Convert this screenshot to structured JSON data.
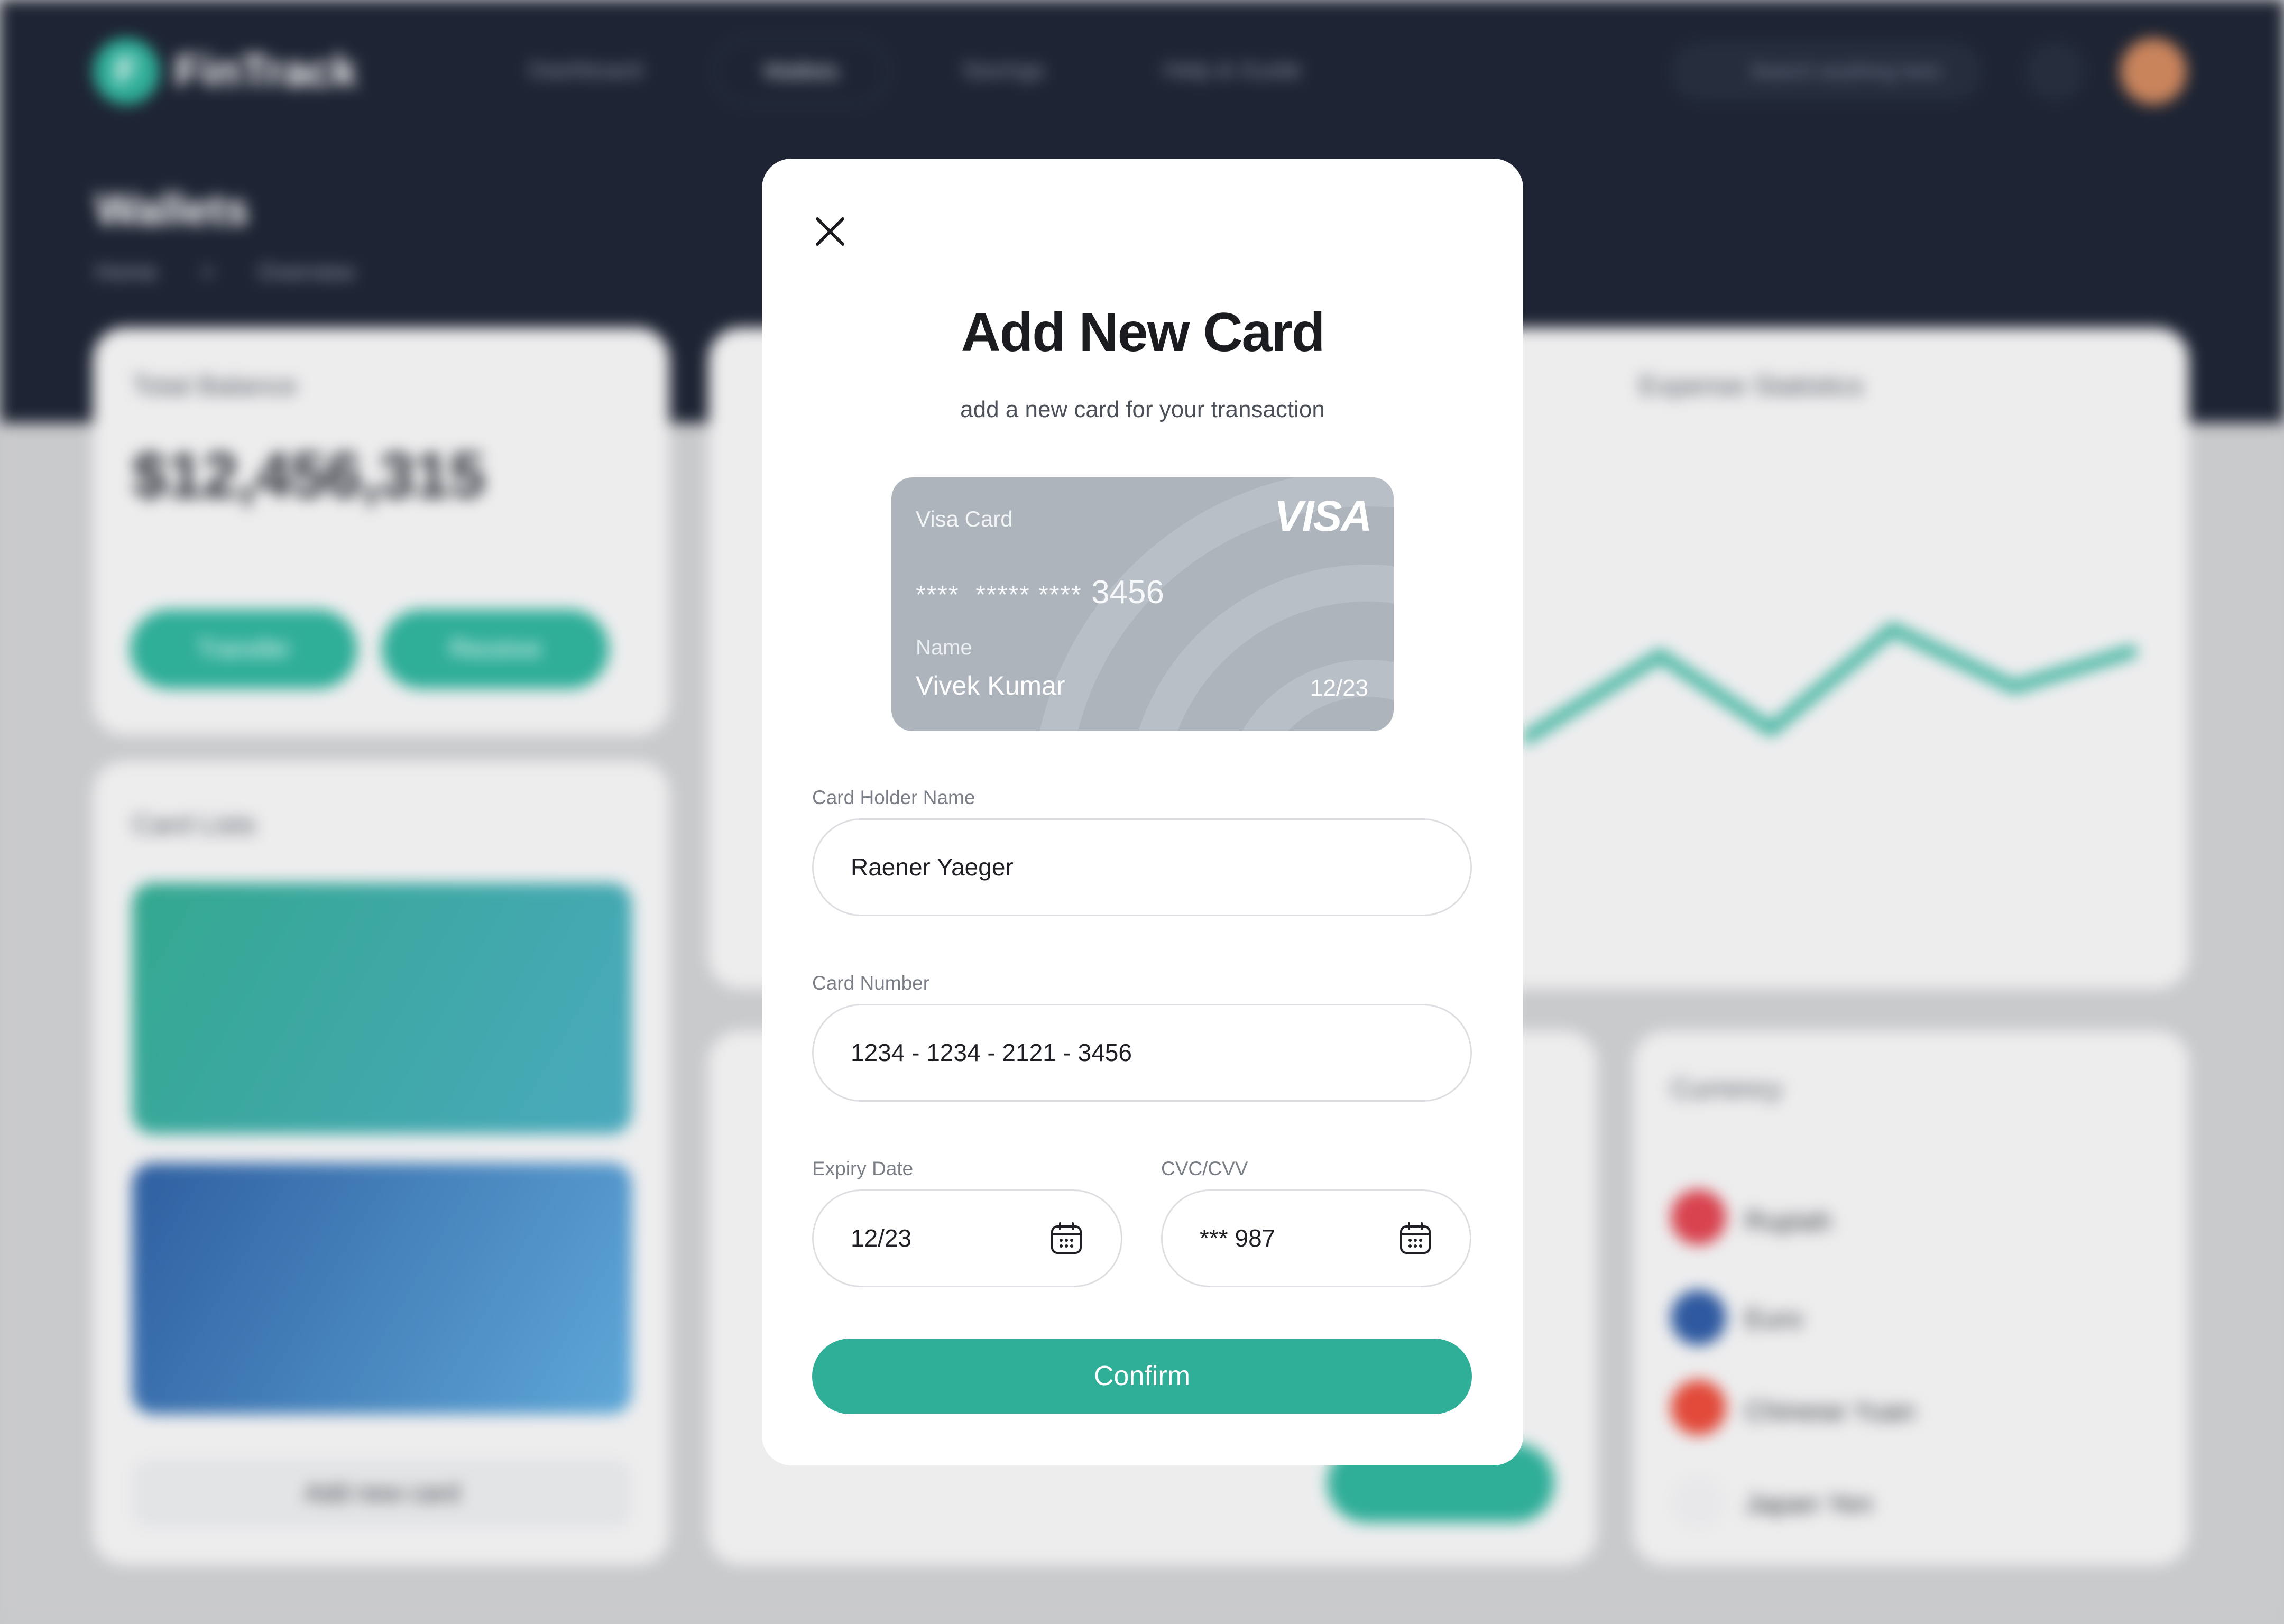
{
  "background": {
    "app_name": "FinTrack",
    "nav": [
      "Dashboard",
      "Wallets",
      "Savings",
      "Help & Guide"
    ],
    "search_placeholder": "Search anything here",
    "page_title": "Wallets",
    "breadcrumb": [
      "Home",
      ">",
      "Overview"
    ],
    "balance_label": "Total Balance",
    "balance_amount": "$12,456,315",
    "transfer_label": "Transfer",
    "receive_label": "Receive",
    "card_lists_label": "Card Lists",
    "add_card_label": "Add new card",
    "stats_label": "Expense Statistics",
    "currency_label": "Currency",
    "currencies": [
      "Rupiah",
      "Euro",
      "Chinese Yuan",
      "Japan Yen"
    ]
  },
  "modal": {
    "title": "Add New Card",
    "subtitle": "add a new card for your transaction",
    "card_preview": {
      "type": "Visa Card",
      "brand": "VISA",
      "masked_number": "****  ***** ****",
      "last_digits": "3456",
      "name_label": "Name",
      "holder_name": "Vivek Kumar",
      "expiry": "12/23"
    },
    "fields": {
      "holder_label": "Card Holder Name",
      "holder_value": "Raener Yaeger",
      "number_label": "Card Number",
      "number_value": "1234 - 1234 - 2121 - 3456",
      "expiry_label": "Expiry Date",
      "expiry_value": "12/23",
      "cvc_label": "CVC/CVV",
      "cvc_value": "*** 987"
    },
    "confirm_label": "Confirm"
  },
  "colors": {
    "accent": "#2fae98",
    "header_bg": "#1e2433",
    "card_preview_bg": "#aeb4bc"
  }
}
